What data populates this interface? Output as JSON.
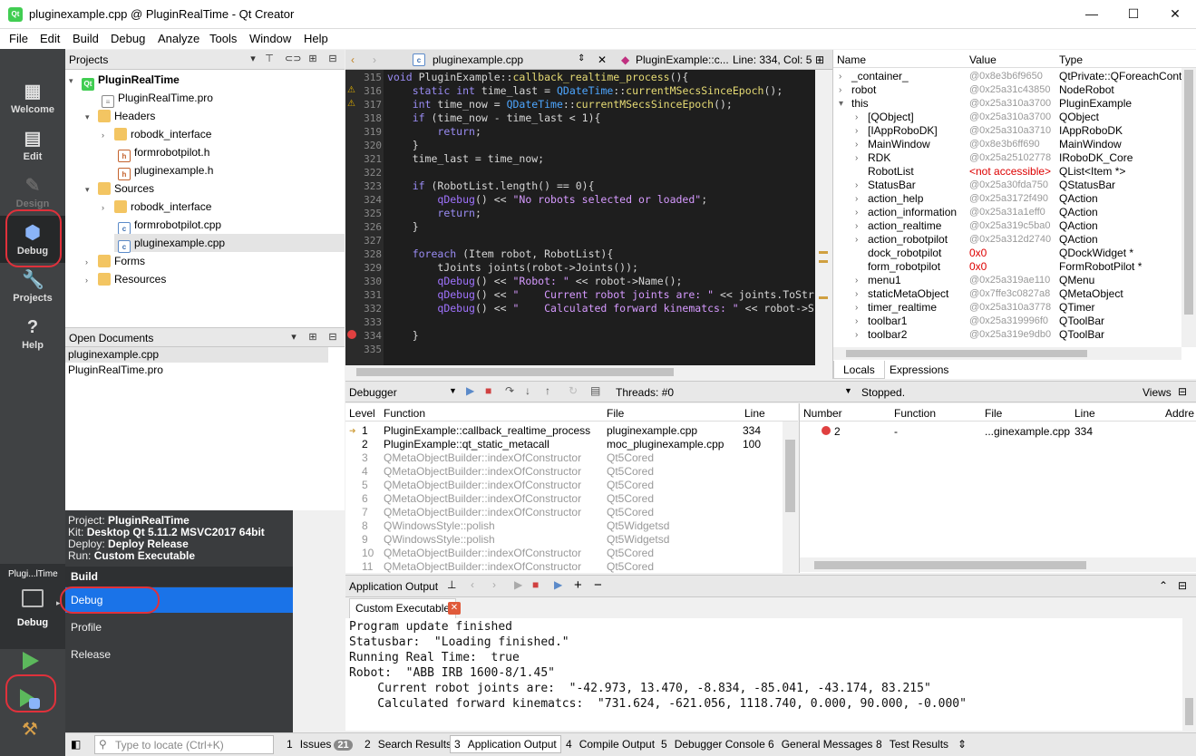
{
  "window": {
    "title": "pluginexample.cpp @ PluginRealTime - Qt Creator",
    "icon_text": "Qt",
    "minimize": "—",
    "maximize": "☐",
    "close": "✕"
  },
  "menu": [
    "File",
    "Edit",
    "Build",
    "Debug",
    "Analyze",
    "Tools",
    "Window",
    "Help"
  ],
  "modes": [
    {
      "label": "Welcome",
      "icon": "grid-icon"
    },
    {
      "label": "Edit",
      "icon": "document-icon"
    },
    {
      "label": "Design",
      "icon": "pencil-icon"
    },
    {
      "label": "Debug",
      "icon": "bug-icon"
    },
    {
      "label": "Projects",
      "icon": "wrench-icon"
    },
    {
      "label": "Help",
      "icon": "question-icon"
    }
  ],
  "kit_selector": {
    "project_short": "Plugi...lTime",
    "mode": "Debug"
  },
  "projects": {
    "header": "Projects",
    "tree": [
      {
        "label": "PluginRealTime",
        "type": "project",
        "arrow": "▾",
        "bold": true
      },
      {
        "label": "PluginRealTime.pro",
        "type": "pro"
      },
      {
        "label": "Headers",
        "type": "folder",
        "arrow": "▾"
      },
      {
        "label": "robodk_interface",
        "type": "folder",
        "arrow": "›"
      },
      {
        "label": "formrobotpilot.h",
        "type": "header"
      },
      {
        "label": "pluginexample.h",
        "type": "header"
      },
      {
        "label": "Sources",
        "type": "folder",
        "arrow": "▾"
      },
      {
        "label": "robodk_interface",
        "type": "folder",
        "arrow": "›"
      },
      {
        "label": "formrobotpilot.cpp",
        "type": "cpp"
      },
      {
        "label": "pluginexample.cpp",
        "type": "cpp",
        "selected": true
      },
      {
        "label": "Forms",
        "type": "folder",
        "arrow": "›"
      },
      {
        "label": "Resources",
        "type": "folder",
        "arrow": "›"
      }
    ]
  },
  "open_documents": {
    "header": "Open Documents",
    "items": [
      "pluginexample.cpp",
      "PluginRealTime.pro"
    ]
  },
  "kit_popup": {
    "project_label": "Project:",
    "project": "PluginRealTime",
    "kit_label": "Kit:",
    "kit": "Desktop Qt 5.11.2 MSVC2017 64bit",
    "deploy_label": "Deploy:",
    "deploy": "Deploy Release",
    "run_label": "Run:",
    "run": "Custom Executable",
    "build_header": "Build",
    "options": [
      "Debug",
      "Profile",
      "Release"
    ]
  },
  "editor": {
    "file": "pluginexample.cpp",
    "symbol": "PluginExample::c...",
    "position": "Line: 334, Col: 5",
    "lines": [
      {
        "n": "315",
        "t": "void PluginExample::callback_realtime_process(){"
      },
      {
        "n": "316",
        "t": "    static int time_last = QDateTime::currentMSecsSinceEpoch();"
      },
      {
        "n": "317",
        "t": "    int time_now = QDateTime::currentMSecsSinceEpoch();"
      },
      {
        "n": "318",
        "t": "    if (time_now - time_last < 1){"
      },
      {
        "n": "319",
        "t": "        return;"
      },
      {
        "n": "320",
        "t": "    }"
      },
      {
        "n": "321",
        "t": "    time_last = time_now;"
      },
      {
        "n": "322",
        "t": ""
      },
      {
        "n": "323",
        "t": "    if (RobotList.length() == 0){"
      },
      {
        "n": "324",
        "t": "        qDebug() << \"No robots selected or loaded\";"
      },
      {
        "n": "325",
        "t": "        return;"
      },
      {
        "n": "326",
        "t": "    }"
      },
      {
        "n": "327",
        "t": ""
      },
      {
        "n": "328",
        "t": "    foreach (Item robot, RobotList){"
      },
      {
        "n": "329",
        "t": "        tJoints joints(robot->Joints());"
      },
      {
        "n": "330",
        "t": "        qDebug() << \"Robot: \" << robot->Name();"
      },
      {
        "n": "331",
        "t": "        qDebug() << \"    Current robot joints are: \" << joints.ToStr"
      },
      {
        "n": "332",
        "t": "        qDebug() << \"    Calculated forward kinematcs: \" << robot->S"
      },
      {
        "n": "333",
        "t": ""
      },
      {
        "n": "334",
        "t": "    }"
      },
      {
        "n": "335",
        "t": ""
      }
    ]
  },
  "locals": {
    "headers": [
      "Name",
      "Value",
      "Type"
    ],
    "rows": [
      {
        "a": "›",
        "i": 0,
        "n": "_container_",
        "v": "@0x8e3b6f9650",
        "t": "QtPrivate::QForeachConta"
      },
      {
        "a": "›",
        "i": 0,
        "n": "robot",
        "v": "@0x25a31c43850",
        "t": "NodeRobot"
      },
      {
        "a": "▾",
        "i": 0,
        "n": "this",
        "v": "@0x25a310a3700",
        "t": "PluginExample"
      },
      {
        "a": "›",
        "i": 1,
        "n": "[QObject]",
        "v": "@0x25a310a3700",
        "t": "QObject"
      },
      {
        "a": "›",
        "i": 1,
        "n": "[IAppRoboDK]",
        "v": "@0x25a310a3710",
        "t": "IAppRoboDK"
      },
      {
        "a": "›",
        "i": 1,
        "n": "MainWindow",
        "v": "@0x8e3b6ff690",
        "t": "MainWindow"
      },
      {
        "a": "›",
        "i": 1,
        "n": "RDK",
        "v": "@0x25a25102778",
        "t": "IRoboDK_Core"
      },
      {
        "a": "",
        "i": 1,
        "n": "RobotList",
        "v": "<not accessible>",
        "t": "QList<Item *>",
        "red": true
      },
      {
        "a": "›",
        "i": 1,
        "n": "StatusBar",
        "v": "@0x25a30fda750",
        "t": "QStatusBar"
      },
      {
        "a": "›",
        "i": 1,
        "n": "action_help",
        "v": "@0x25a3172f490",
        "t": "QAction"
      },
      {
        "a": "›",
        "i": 1,
        "n": "action_information",
        "v": "@0x25a31a1eff0",
        "t": "QAction"
      },
      {
        "a": "›",
        "i": 1,
        "n": "action_realtime",
        "v": "@0x25a319c5ba0",
        "t": "QAction"
      },
      {
        "a": "›",
        "i": 1,
        "n": "action_robotpilot",
        "v": "@0x25a312d2740",
        "t": "QAction"
      },
      {
        "a": "",
        "i": 1,
        "n": "dock_robotpilot",
        "v": "0x0",
        "t": "QDockWidget *",
        "red": true
      },
      {
        "a": "",
        "i": 1,
        "n": "form_robotpilot",
        "v": "0x0",
        "t": "FormRobotPilot *",
        "red": true
      },
      {
        "a": "›",
        "i": 1,
        "n": "menu1",
        "v": "@0x25a319ae110",
        "t": "QMenu"
      },
      {
        "a": "›",
        "i": 1,
        "n": "staticMetaObject",
        "v": "@0x7ffe3c0827a8",
        "t": "QMetaObject"
      },
      {
        "a": "›",
        "i": 1,
        "n": "timer_realtime",
        "v": "@0x25a310a3778",
        "t": "QTimer"
      },
      {
        "a": "›",
        "i": 1,
        "n": "toolbar1",
        "v": "@0x25a319996f0",
        "t": "QToolBar"
      },
      {
        "a": "›",
        "i": 1,
        "n": "toolbar2",
        "v": "@0x25a319e9db0",
        "t": "QToolBar"
      }
    ],
    "tabs": [
      "Locals",
      "Expressions"
    ]
  },
  "debugger_bar": {
    "selector": "Debugger",
    "threads": "Threads: #0",
    "state": "Stopped.",
    "views": "Views"
  },
  "stack": {
    "headers": [
      "Level",
      "Function",
      "File",
      "Line"
    ],
    "rows": [
      {
        "l": "1",
        "f": "PluginExample::callback_realtime_process",
        "file": "pluginexample.cpp",
        "line": "334",
        "cur": true
      },
      {
        "l": "2",
        "f": "PluginExample::qt_static_metacall",
        "file": "moc_pluginexample.cpp",
        "line": "100"
      },
      {
        "l": "3",
        "f": "QMetaObjectBuilder::indexOfConstructor",
        "file": "Qt5Cored",
        "line": "",
        "grey": true
      },
      {
        "l": "4",
        "f": "QMetaObjectBuilder::indexOfConstructor",
        "file": "Qt5Cored",
        "line": "",
        "grey": true
      },
      {
        "l": "5",
        "f": "QMetaObjectBuilder::indexOfConstructor",
        "file": "Qt5Cored",
        "line": "",
        "grey": true
      },
      {
        "l": "6",
        "f": "QMetaObjectBuilder::indexOfConstructor",
        "file": "Qt5Cored",
        "line": "",
        "grey": true
      },
      {
        "l": "7",
        "f": "QMetaObjectBuilder::indexOfConstructor",
        "file": "Qt5Cored",
        "line": "",
        "grey": true
      },
      {
        "l": "8",
        "f": "QWindowsStyle::polish",
        "file": "Qt5Widgetsd",
        "line": "",
        "grey": true
      },
      {
        "l": "9",
        "f": "QWindowsStyle::polish",
        "file": "Qt5Widgetsd",
        "line": "",
        "grey": true
      },
      {
        "l": "10",
        "f": "QMetaObjectBuilder::indexOfConstructor",
        "file": "Qt5Cored",
        "line": "",
        "grey": true
      },
      {
        "l": "11",
        "f": "QMetaObjectBuilder::indexOfConstructor",
        "file": "Qt5Cored",
        "line": "",
        "grey": true
      }
    ]
  },
  "breakpoints": {
    "headers": [
      "Number",
      "Function",
      "File",
      "Line",
      "Addre"
    ],
    "rows": [
      {
        "num": "2",
        "func": "-",
        "file": "...ginexample.cpp",
        "line": "334"
      }
    ]
  },
  "app_output": {
    "header": "Application Output",
    "tab": "Custom Executable",
    "lines": [
      "Program update finished",
      "Statusbar:  \"Loading finished.\"",
      "Running Real Time:  true",
      "Robot:  \"ABB IRB 1600-8/1.45\"",
      "    Current robot joints are:  \"-42.973, 13.470, -8.834, -85.041, -43.174, 83.215\"",
      "    Calculated forward kinematcs:  \"731.624, -621.056, 1118.740, 0.000, 90.000, -0.000\""
    ]
  },
  "statusbar": {
    "locate_placeholder": "Type to locate (Ctrl+K)",
    "tabs": [
      {
        "num": "1",
        "label": "Issues",
        "badge": "21"
      },
      {
        "num": "2",
        "label": "Search Results"
      },
      {
        "num": "3",
        "label": "Application Output",
        "active": true
      },
      {
        "num": "4",
        "label": "Compile Output"
      },
      {
        "num": "5",
        "label": "Debugger Console"
      },
      {
        "num": "6",
        "label": "General Messages"
      },
      {
        "num": "8",
        "label": "Test Results"
      }
    ]
  }
}
